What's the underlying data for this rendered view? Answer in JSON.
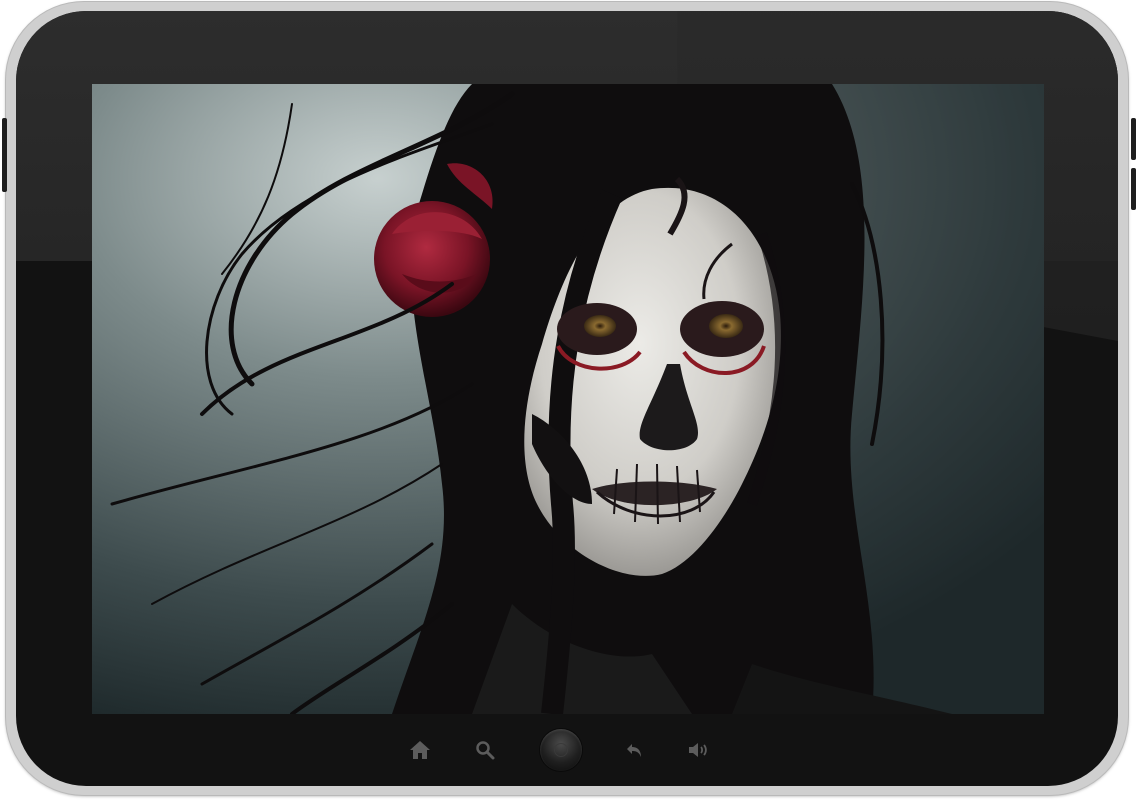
{
  "device": {
    "type": "tablet",
    "frame_color": "#cfcfcf",
    "bezel_color": "#121212"
  },
  "screen": {
    "content": "wallpaper-image",
    "palette": {
      "background": "#3c4a4c",
      "hair": "#0e0c0d",
      "face": "#d8d6d2",
      "rose": "#7a1426",
      "eyes": "#6b5226"
    }
  },
  "navbar": {
    "icons": [
      {
        "name": "home-icon",
        "glyph": "house"
      },
      {
        "name": "search-icon",
        "glyph": "magnifier"
      },
      {
        "name": "center-home-button",
        "glyph": "circle"
      },
      {
        "name": "back-icon",
        "glyph": "curved-arrow"
      },
      {
        "name": "volume-icon",
        "glyph": "speaker"
      }
    ]
  }
}
